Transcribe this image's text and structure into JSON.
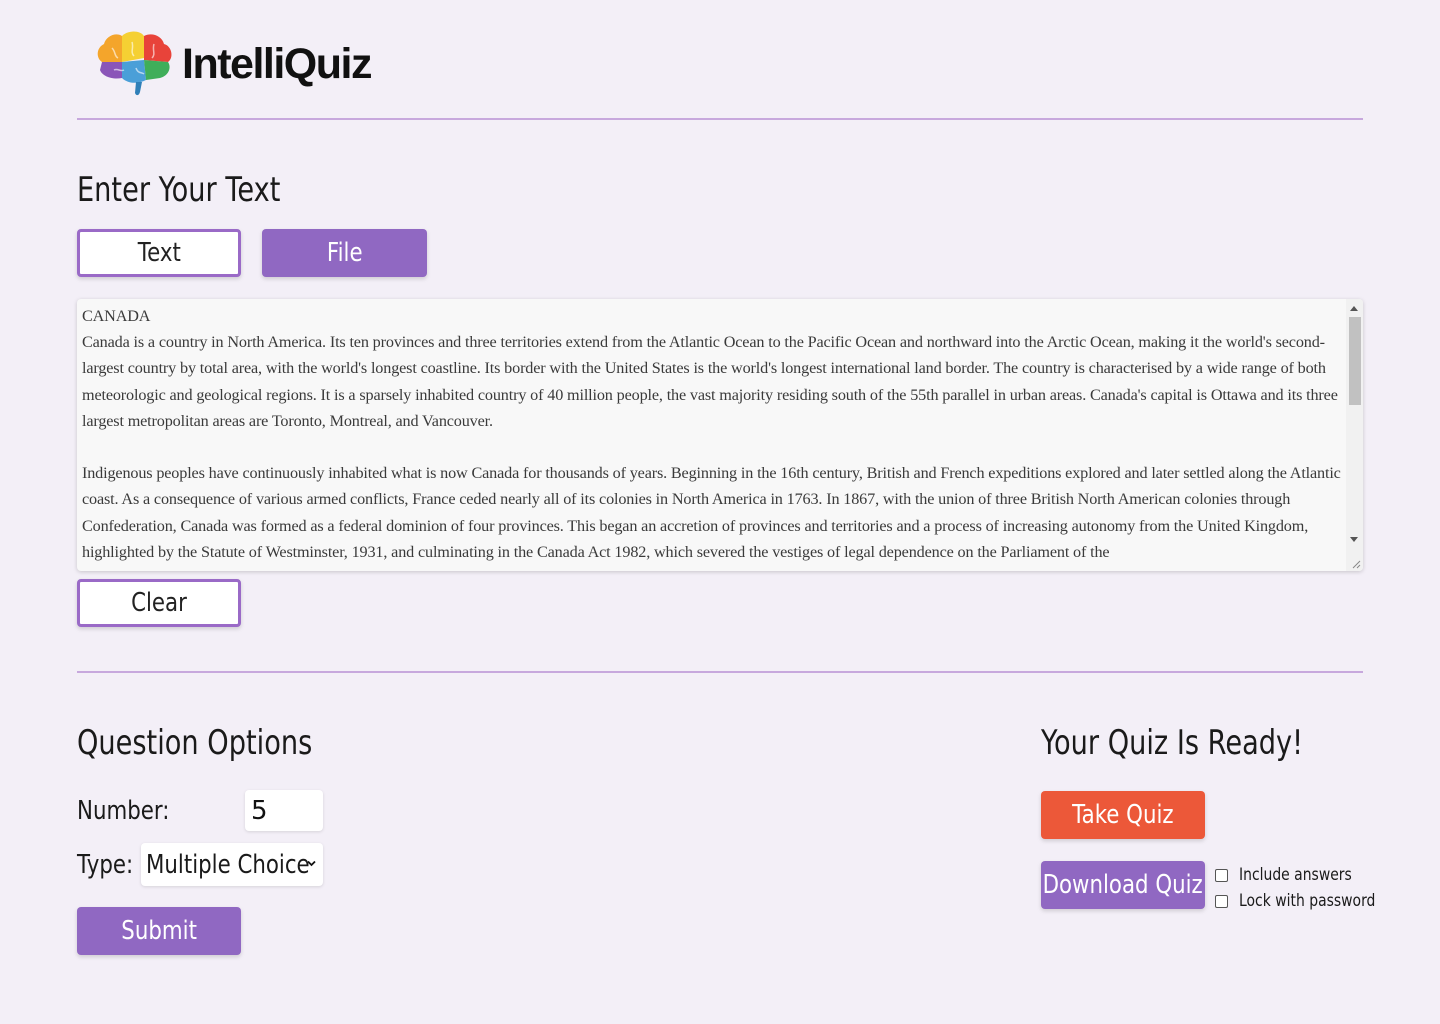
{
  "app": {
    "name": "IntelliQuiz"
  },
  "input_section": {
    "heading": "Enter Your Text",
    "tabs": [
      {
        "label": "Text"
      },
      {
        "label": "File"
      }
    ],
    "textarea": {
      "paragraphs": [
        "CANADA\nCanada is a country in North America. Its ten provinces and three territories extend from the Atlantic Ocean to the Pacific Ocean and northward into the Arctic Ocean, making it the world's second-largest country by total area, with the world's longest coastline. Its border with the United States is the world's longest international land border. The country is characterised by a wide range of both meteorologic and geological regions. It is a sparsely inhabited country of 40 million people, the vast majority residing south of the 55th parallel in urban areas. Canada's capital is Ottawa and its three largest metropolitan areas are Toronto, Montreal, and Vancouver.",
        "Indigenous peoples have continuously inhabited what is now Canada for thousands of years. Beginning in the 16th century, British and French expeditions explored and later settled along the Atlantic coast. As a consequence of various armed conflicts, France ceded nearly all of its colonies in North America in 1763. In 1867, with the union of three British North American colonies through Confederation, Canada was formed as a federal dominion of four provinces. This began an accretion of provinces and territories and a process of increasing autonomy from the United Kingdom, highlighted by the Statute of Westminster, 1931, and culminating in the Canada Act 1982, which severed the vestiges of legal dependence on the Parliament of the"
      ]
    },
    "clear_label": "Clear"
  },
  "options": {
    "heading": "Question Options",
    "number_label": "Number:",
    "number_value": "5",
    "type_label": "Type:",
    "type_value": "Multiple Choice",
    "submit_label": "Submit"
  },
  "ready": {
    "heading": "Your Quiz Is Ready!",
    "take_label": "Take Quiz",
    "download_label": "Download Quiz",
    "include_answers_label": "Include answers",
    "lock_label": "Lock with password"
  },
  "colors": {
    "accent": "#9068c2",
    "orange": "#ec5839",
    "background": "#f3eff7",
    "divider": "#c7a8dd"
  }
}
